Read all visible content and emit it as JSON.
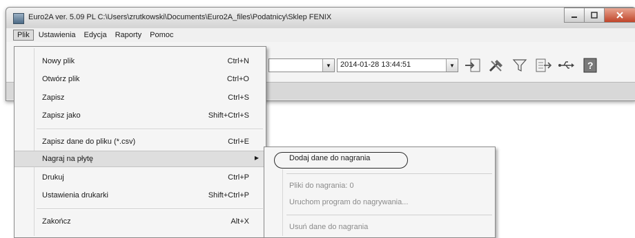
{
  "window": {
    "title": "Euro2A ver. 5.09 PL   C:\\Users\\zrutkowski\\Documents\\Euro2A_files\\Podatnicy\\Sklep FENIX",
    "controls": [
      "minimize",
      "maximize",
      "close"
    ]
  },
  "menubar": [
    {
      "label": "Plik",
      "active": true
    },
    {
      "label": "Ustawienia"
    },
    {
      "label": "Edycja"
    },
    {
      "label": "Raporty"
    },
    {
      "label": "Pomoc"
    }
  ],
  "toolbar": {
    "combo1": {
      "value": ""
    },
    "combo2": {
      "value": "2014-01-28 13:44:51"
    },
    "icons": [
      "import-icon",
      "tools-icon",
      "filter-icon",
      "export-icon",
      "usb-icon",
      "help-icon"
    ]
  },
  "plik_menu": [
    {
      "label": "Nowy plik",
      "shortcut": "Ctrl+N"
    },
    {
      "label": "Otwórz plik",
      "shortcut": "Ctrl+O"
    },
    {
      "label": "Zapisz",
      "shortcut": "Ctrl+S"
    },
    {
      "label": "Zapisz jako",
      "shortcut": "Shift+Ctrl+S"
    },
    {
      "label": "Zapisz dane do pliku (*.csv)",
      "shortcut": "Ctrl+E"
    },
    {
      "label": "Nagraj na płytę",
      "shortcut": "",
      "submenu": true
    },
    {
      "label": "Drukuj",
      "shortcut": "Ctrl+P"
    },
    {
      "label": "Ustawienia drukarki",
      "shortcut": "Shift+Ctrl+P"
    },
    {
      "label": "Zakończ",
      "shortcut": "Alt+X"
    }
  ],
  "submenu": [
    {
      "label": "Dodaj dane do nagrania",
      "enabled": true
    },
    {
      "label": "Pliki do nagrania: 0",
      "enabled": false
    },
    {
      "label": "Uruchom program do nagrywania...",
      "enabled": false
    },
    {
      "label": "Usuń dane do nagrania",
      "enabled": false
    }
  ]
}
